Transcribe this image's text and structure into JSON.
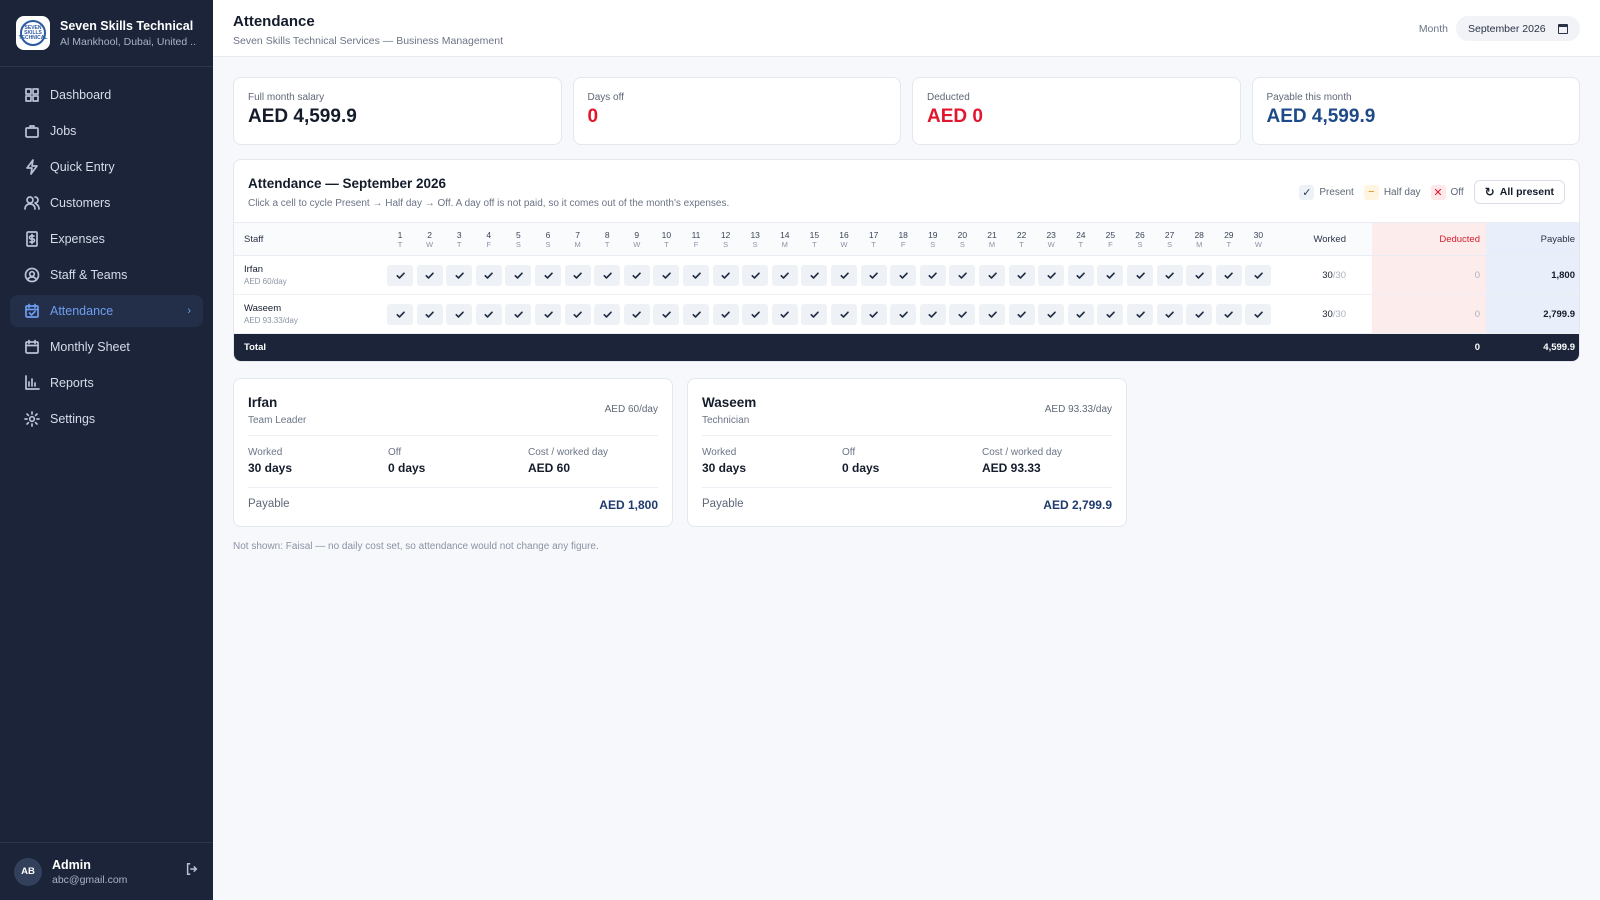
{
  "brand": {
    "name": "Seven Skills Technical ...",
    "location": "Al Mankhool, Dubai, United ...",
    "logo_text": "SEVEN SKILLS TECHNICAL"
  },
  "nav": [
    {
      "label": "Dashboard",
      "icon": "dashboard-icon"
    },
    {
      "label": "Jobs",
      "icon": "briefcase-icon"
    },
    {
      "label": "Quick Entry",
      "icon": "lightning-icon"
    },
    {
      "label": "Customers",
      "icon": "users-icon"
    },
    {
      "label": "Expenses",
      "icon": "dollar-icon"
    },
    {
      "label": "Staff & Teams",
      "icon": "user-circle-icon"
    },
    {
      "label": "Attendance",
      "icon": "calendar-check-icon",
      "active": true
    },
    {
      "label": "Monthly Sheet",
      "icon": "calendar-icon"
    },
    {
      "label": "Reports",
      "icon": "bar-chart-icon"
    },
    {
      "label": "Settings",
      "icon": "gear-icon"
    }
  ],
  "user": {
    "initials": "AB",
    "name": "Admin",
    "email": "abc@gmail.com"
  },
  "header": {
    "title": "Attendance",
    "subtitle": "Seven Skills Technical Services — Business Management",
    "month_label": "Month",
    "month_value": "September  2026"
  },
  "stats": [
    {
      "label": "Full month salary",
      "value": "AED 4,599.9",
      "color": "#141c2b"
    },
    {
      "label": "Days off",
      "value": "0",
      "color": "#e1172e"
    },
    {
      "label": "Deducted",
      "value": "AED 0",
      "color": "#e1172e"
    },
    {
      "label": "Payable this month",
      "value": "AED 4,599.9",
      "color": "#1e4a8a"
    }
  ],
  "panel": {
    "title": "Attendance — September 2026",
    "subtitle": "Click a cell to cycle Present → Half day → Off. A day off is not paid, so it comes out of the month's expenses.",
    "legend": {
      "present": "Present",
      "half": "Half day",
      "off": "Off"
    },
    "all_present": "All present"
  },
  "table": {
    "headers": {
      "staff": "Staff",
      "worked": "Worked",
      "deducted": "Deducted",
      "payable": "Payable"
    },
    "days": [
      {
        "d": "1",
        "w": "T"
      },
      {
        "d": "2",
        "w": "W"
      },
      {
        "d": "3",
        "w": "T"
      },
      {
        "d": "4",
        "w": "F"
      },
      {
        "d": "5",
        "w": "S"
      },
      {
        "d": "6",
        "w": "S"
      },
      {
        "d": "7",
        "w": "M"
      },
      {
        "d": "8",
        "w": "T"
      },
      {
        "d": "9",
        "w": "W"
      },
      {
        "d": "10",
        "w": "T"
      },
      {
        "d": "11",
        "w": "F"
      },
      {
        "d": "12",
        "w": "S"
      },
      {
        "d": "13",
        "w": "S"
      },
      {
        "d": "14",
        "w": "M"
      },
      {
        "d": "15",
        "w": "T"
      },
      {
        "d": "16",
        "w": "W"
      },
      {
        "d": "17",
        "w": "T"
      },
      {
        "d": "18",
        "w": "F"
      },
      {
        "d": "19",
        "w": "S"
      },
      {
        "d": "20",
        "w": "S"
      },
      {
        "d": "21",
        "w": "M"
      },
      {
        "d": "22",
        "w": "T"
      },
      {
        "d": "23",
        "w": "W"
      },
      {
        "d": "24",
        "w": "T"
      },
      {
        "d": "25",
        "w": "F"
      },
      {
        "d": "26",
        "w": "S"
      },
      {
        "d": "27",
        "w": "S"
      },
      {
        "d": "28",
        "w": "M"
      },
      {
        "d": "29",
        "w": "T"
      },
      {
        "d": "30",
        "w": "W"
      }
    ],
    "rows": [
      {
        "name": "Irfan",
        "rate": "AED 60/day",
        "worked": "30",
        "worked_total": "/30",
        "deducted": "0",
        "payable": "1,800",
        "status": "present"
      },
      {
        "name": "Waseem",
        "rate": "AED 93.33/day",
        "worked": "30",
        "worked_total": "/30",
        "deducted": "0",
        "payable": "2,799.9",
        "status": "present"
      }
    ],
    "total": {
      "label": "Total",
      "deducted": "0",
      "payable": "4,599.9"
    }
  },
  "employees": [
    {
      "name": "Irfan",
      "role": "Team Leader",
      "rate": "AED 60/day",
      "worked_label": "Worked",
      "worked": "30 days",
      "off_label": "Off",
      "off": "0 days",
      "cost_label": "Cost / worked day",
      "cost": "AED 60",
      "payable_label": "Payable",
      "payable": "AED 1,800"
    },
    {
      "name": "Waseem",
      "role": "Technician",
      "rate": "AED 93.33/day",
      "worked_label": "Worked",
      "worked": "30 days",
      "off_label": "Off",
      "off": "0 days",
      "cost_label": "Cost / worked day",
      "cost": "AED 93.33",
      "payable_label": "Payable",
      "payable": "AED 2,799.9"
    }
  ],
  "footnote": "Not shown: Faisal — no daily cost set, so attendance would not change any figure."
}
